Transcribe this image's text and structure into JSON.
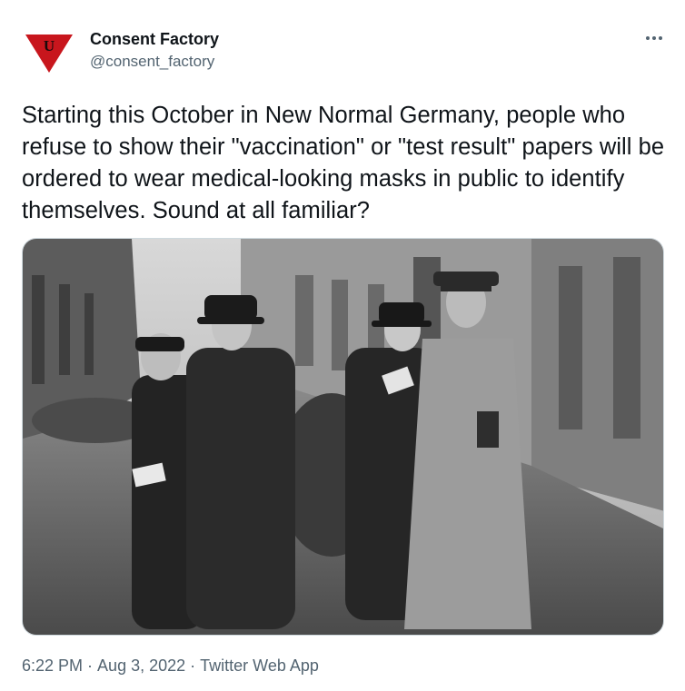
{
  "author": {
    "name": "Consent Factory",
    "handle": "@consent_factory",
    "avatar_letter": "U",
    "avatar_color": "#c8161d"
  },
  "more_icon": "more-horizontal-icon",
  "tweet": {
    "text": "Starting this October in New Normal Germany, people who refuse to show their \"vaccination\" or \"test result\" papers will be ordered to wear medical-looking masks in public to identify themselves. Sound at all familiar?"
  },
  "meta": {
    "time": "6:22 PM",
    "separator": "·",
    "date": "Aug 3, 2022",
    "source": "Twitter Web App"
  },
  "colors": {
    "text": "#0f1419",
    "secondary": "#536471",
    "border": "#cfd9de"
  }
}
